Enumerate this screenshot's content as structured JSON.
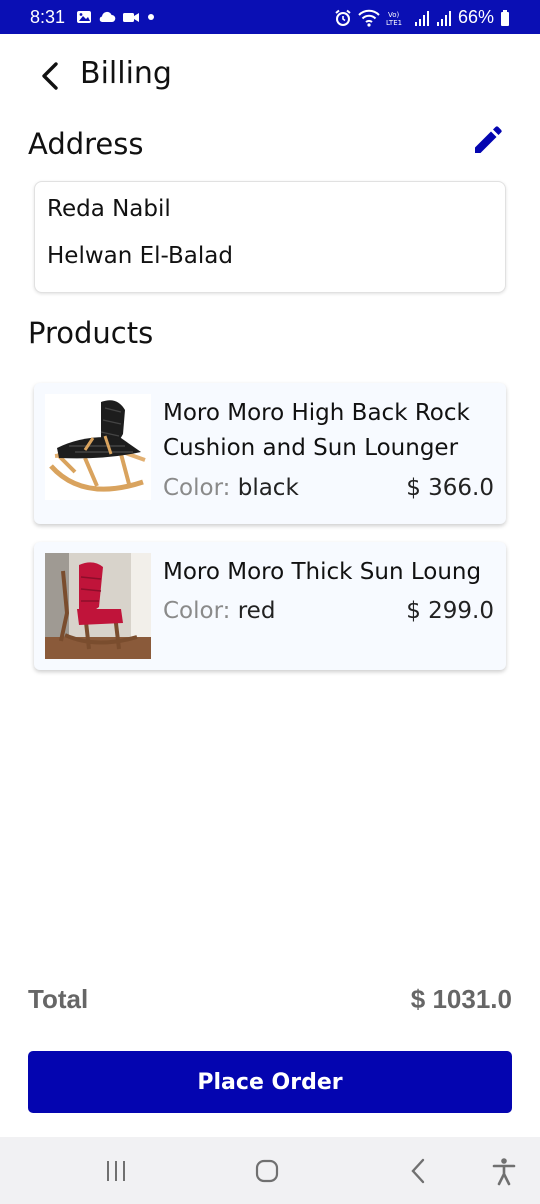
{
  "status_bar": {
    "time": "8:31",
    "battery": "66%",
    "left_icons": [
      "gallery-icon",
      "cloud-icon",
      "video-icon",
      "dot-icon"
    ],
    "right_icons": [
      "alarm-icon",
      "wifi-icon",
      "volte-icon",
      "signal-icon",
      "signal-icon",
      "battery-icon"
    ],
    "volte_label": "Vo)\nLTE1"
  },
  "header": {
    "title": "Billing",
    "back_icon": "chevron-left-icon"
  },
  "address": {
    "section_title": "Address",
    "edit_icon": "pencil-icon",
    "name": "Reda  Nabil",
    "line": "Helwan El-Balad"
  },
  "products": {
    "section_title": "Products",
    "items": [
      {
        "name": "Moro Moro High Back Rocking Chair with Cushion and Sun Lounger",
        "name_line1": "Moro Moro High Back Rock",
        "name_line2": "Cushion and Sun Lounger",
        "color_label": "Color: ",
        "color": "black",
        "price": "$ 366.0"
      },
      {
        "name": "Moro Moro Thick Sun Lounger",
        "name_line1": "Moro Moro Thick Sun Loung",
        "color_label": "Color: ",
        "color": "red",
        "price": "$ 299.0"
      }
    ]
  },
  "total": {
    "label": "Total",
    "value": "$ 1031.0"
  },
  "place_order_label": "Place Order",
  "nav": {
    "icons": [
      "recents-icon",
      "home-icon",
      "back-icon",
      "accessibility-icon"
    ]
  },
  "colors": {
    "primary": "#0405b0",
    "status_bar": "#0a0fb4"
  }
}
